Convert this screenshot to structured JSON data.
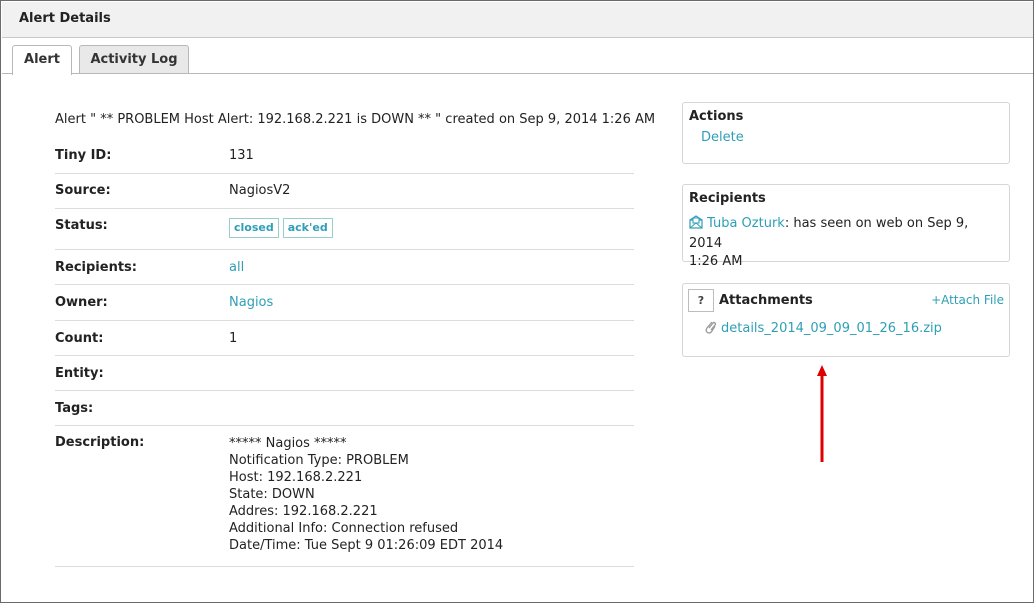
{
  "window": {
    "title": "Alert Details"
  },
  "tabs": [
    {
      "label": "Alert"
    },
    {
      "label": "Activity Log"
    }
  ],
  "alert": {
    "headline": "Alert \" ** PROBLEM Host Alert: 192.168.2.221 is DOWN ** \" created on Sep 9, 2014 1:26 AM"
  },
  "fields": {
    "tiny_id": {
      "label": "Tiny ID:",
      "value": "131"
    },
    "source": {
      "label": "Source:",
      "value": "NagiosV2"
    },
    "status": {
      "label": "Status:",
      "badges": [
        "closed",
        "ack'ed"
      ]
    },
    "recipients": {
      "label": "Recipients:",
      "value": "all"
    },
    "owner": {
      "label": "Owner:",
      "value": "Nagios"
    },
    "count": {
      "label": "Count:",
      "value": "1"
    },
    "entity": {
      "label": "Entity:",
      "value": ""
    },
    "tags": {
      "label": "Tags:",
      "value": ""
    },
    "description": {
      "label": "Description:",
      "lines": [
        "***** Nagios *****",
        "Notification Type: PROBLEM",
        "Host: 192.168.2.221",
        "State: DOWN",
        "Addres: 192.168.2.221",
        "Additional Info: Connection refused",
        "Date/Time: Tue Sept 9 01:26:09 EDT 2014"
      ]
    }
  },
  "actions_panel": {
    "title": "Actions",
    "delete_label": "Delete"
  },
  "recipients_panel": {
    "title": "Recipients",
    "name": "Tuba Ozturk",
    "status_text": ": has seen on web on Sep 9, 2014",
    "status_text_2": "1:26 AM"
  },
  "attachments_panel": {
    "help_label": "?",
    "title": "Attachments",
    "attach_label": "+Attach File",
    "file_name": "details_2014_09_09_01_26_16.zip"
  },
  "colors": {
    "link": "#2e9fb6",
    "annotation_arrow": "#e00000"
  }
}
